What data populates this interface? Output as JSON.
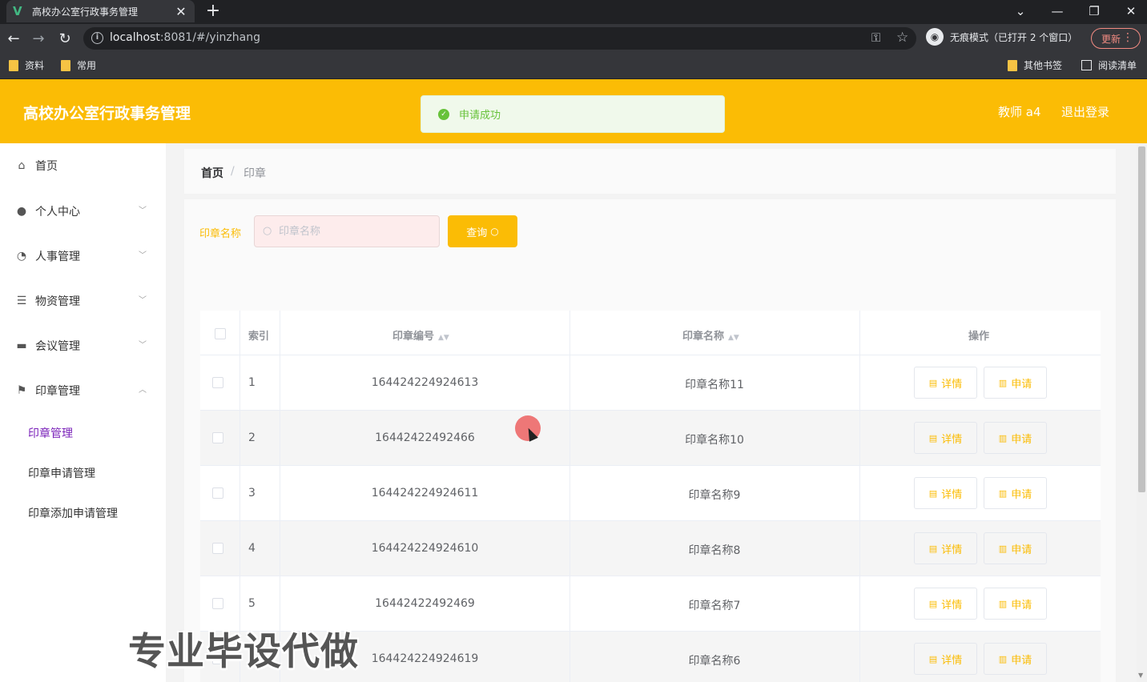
{
  "browser": {
    "tab_title": "高校办公室行政事务管理",
    "tab_favicon": "V",
    "tab_close": "✕",
    "new_tab": "+",
    "url_host": "localhost",
    "url_rest": ":8081/#/yinzhang",
    "incognito_label": "无痕模式（已打开 2 个窗口）",
    "update_label": "更新",
    "bookmarks": [
      "资料",
      "常用"
    ],
    "other_bookmarks": "其他书签",
    "reading_list": "阅读清单"
  },
  "header": {
    "title": "高校办公室行政事务管理",
    "user": "教师 a4",
    "logout": "退出登录"
  },
  "toast": {
    "message": "申请成功"
  },
  "sidebar": {
    "items": [
      {
        "label": "首页",
        "icon": "home-icon",
        "glyph": "⌂"
      },
      {
        "label": "个人中心",
        "icon": "user-icon",
        "glyph": "●"
      },
      {
        "label": "人事管理",
        "icon": "gauge-icon",
        "glyph": "◔"
      },
      {
        "label": "物资管理",
        "icon": "list-icon",
        "glyph": "☰"
      },
      {
        "label": "会议管理",
        "icon": "printer-icon",
        "glyph": "▬"
      },
      {
        "label": "印章管理",
        "icon": "flag-icon",
        "glyph": "⚑"
      }
    ],
    "submenu": [
      "印章管理",
      "印章申请管理",
      "印章添加申请管理"
    ]
  },
  "breadcrumb": {
    "home": "首页",
    "sep": "/",
    "current": "印章"
  },
  "search": {
    "label": "印章名称",
    "placeholder": "印章名称",
    "button": "查询"
  },
  "table": {
    "columns": {
      "index": "索引",
      "code": "印章编号",
      "name": "印章名称",
      "actions": "操作"
    },
    "detail_label": "详情",
    "apply_label": "申请",
    "rows": [
      {
        "index": "1",
        "code": "164424224924613",
        "name": "印章名称11"
      },
      {
        "index": "2",
        "code": "16442422492466",
        "name": "印章名称10"
      },
      {
        "index": "3",
        "code": "164424224924611",
        "name": "印章名称9"
      },
      {
        "index": "4",
        "code": "164424224924610",
        "name": "印章名称8"
      },
      {
        "index": "5",
        "code": "16442422492469",
        "name": "印章名称7"
      },
      {
        "index": "6",
        "code": "164424224924619",
        "name": "印章名称6"
      }
    ]
  },
  "watermark": "专业毕设代做",
  "colors": {
    "accent": "#fbbc05",
    "active_submenu": "#7a22b9",
    "success": "#67c23a"
  }
}
